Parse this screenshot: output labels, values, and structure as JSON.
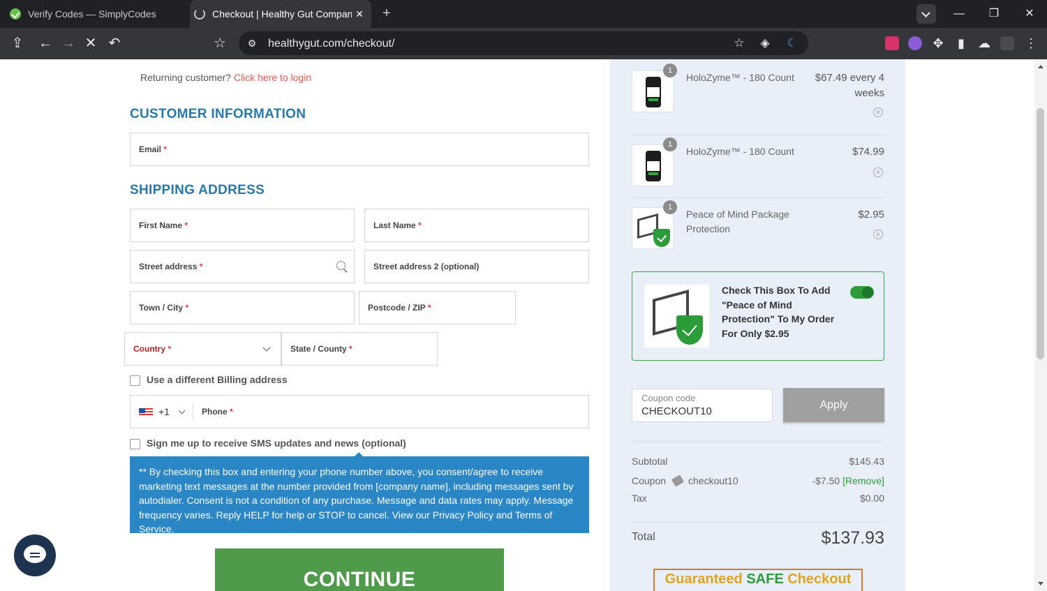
{
  "browser": {
    "tabs": [
      {
        "title": "Verify Codes — SimplyCodes"
      },
      {
        "title": "Checkout | Healthy Gut Company"
      }
    ],
    "url": "healthygut.com/checkout/"
  },
  "form": {
    "returning_text": "Returning customer?",
    "login_link": "Click here to login",
    "customer_info_title": "CUSTOMER INFORMATION",
    "email_label": "Email",
    "shipping_title": "SHIPPING ADDRESS",
    "first_name_label": "First Name",
    "last_name_label": "Last Name",
    "street_label": "Street address",
    "street2_label": "Street address 2 (optional)",
    "city_label": "Town / City",
    "zip_label": "Postcode / ZIP",
    "country_label": "Country",
    "state_label": "State / County",
    "billing_checkbox_label": "Use a different Billing address",
    "dial_code": "+1",
    "phone_label": "Phone",
    "required_mark": "*",
    "sms_checkbox_label": "Sign me up to receive SMS updates and news (optional)",
    "sms_notice": "** By checking this box and entering your phone number above, you consent/agree to receive marketing text messages at the number provided from [company name], including messages sent by autodialer. Consent is not a condition of any purchase. Message and data rates may apply. Message frequency varies. Reply HELP for help or STOP to cancel. View our Privacy Policy and Terms of Service.",
    "continue_label": "CONTINUE"
  },
  "summary": {
    "items": [
      {
        "qty": "1",
        "name": "HoloZyme™ - 180 Count",
        "price": "$67.49 every 4 weeks"
      },
      {
        "qty": "1",
        "name": "HoloZyme™ - 180 Count",
        "price": "$74.99"
      },
      {
        "qty": "1",
        "name": "Peace of Mind Package Protection",
        "price": "$2.95"
      }
    ],
    "promo_text": "Check This Box To Add \"Peace of Mind Protection\" To My Order For Only $2.95",
    "promo_enabled": true,
    "coupon_placeholder": "Coupon code",
    "coupon_value": "CHECKOUT10",
    "apply_label": "Apply",
    "subtotal_label": "Subtotal",
    "subtotal_value": "$145.43",
    "coupon_label": "Coupon",
    "coupon_code": "checkout10",
    "coupon_discount": "-$7.50",
    "remove_label": "[Remove]",
    "tax_label": "Tax",
    "tax_value": "$0.00",
    "total_label": "Total",
    "total_value": "$137.93",
    "guarantee_part1": "Guaranteed ",
    "guarantee_part2": "SAFE",
    "guarantee_part3": " Checkout"
  },
  "colors": {
    "accent": "#2979a8",
    "notice_bg": "#2b86c5",
    "continue_bg": "#4f9a4b",
    "summary_bg": "#e8eff8"
  }
}
